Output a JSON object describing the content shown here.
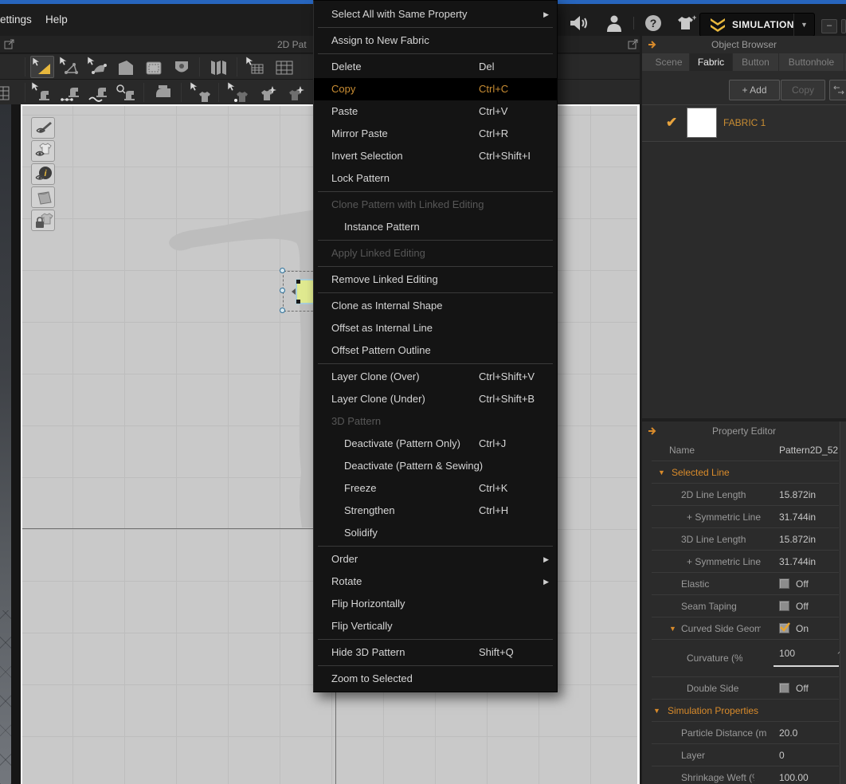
{
  "menubar": {
    "items": [
      "ettings",
      "Help"
    ]
  },
  "topright": {
    "icons": [
      "speaker-icon",
      "user-icon",
      "help-icon",
      "add-garment-icon"
    ],
    "simulation_label": "SIMULATION",
    "minimize_label": "–"
  },
  "pattern_window": {
    "title": "2D Pat",
    "toolbar_row1": [
      "transform-pattern-tool",
      "edit-pattern-tool",
      "edit-curvature-tool",
      "polygon-tool",
      "rectangle-tool",
      "dart-tool",
      "sep",
      "pleats-tool",
      "sep",
      "trace-tool",
      "grid-tool"
    ],
    "toolbar_row2": [
      "edit-sewing-tool",
      "free-sewing-tool",
      "curved-sewing-tool",
      "detail-sewing-tool",
      "sep",
      "iron-tool",
      "sep",
      "select-garment-tool",
      "sep",
      "pin-garment-tool",
      "sparkle-garment-tool",
      "star-garment-tool"
    ],
    "canvas_buttons": [
      "show-needle-toggle",
      "show-garment-toggle",
      "show-info-toggle",
      "show-fabric-toggle",
      "lock-garment-toggle"
    ]
  },
  "object_browser": {
    "title": "Object Browser",
    "tabs": [
      "Scene",
      "Fabric",
      "Button",
      "Buttonhole"
    ],
    "active_tab": "Fabric",
    "add_label": "+  Add",
    "copy_label": "Copy",
    "fabric_item": {
      "name": "FABRIC 1",
      "checked": true
    }
  },
  "property_editor": {
    "title": "Property Editor",
    "rows": [
      {
        "type": "text",
        "label": "Name",
        "value": "Pattern2D_52",
        "indent": 1
      },
      {
        "type": "section",
        "label": "Selected Line",
        "level": 1
      },
      {
        "type": "text",
        "label": "2D Line Length",
        "value": "15.872in",
        "indent": 2,
        "clip": 83
      },
      {
        "type": "text",
        "label": "+ Symmetric Line",
        "value": "31.744in",
        "indent": 3
      },
      {
        "type": "text",
        "label": "3D Line Length",
        "value": "15.872in",
        "indent": 2,
        "clip": 83
      },
      {
        "type": "text",
        "label": "+ Symmetric Line",
        "value": "31.744in",
        "indent": 3
      },
      {
        "type": "checkbox",
        "label": "Elastic",
        "value": "Off",
        "checked": false,
        "indent": 2
      },
      {
        "type": "checkbox",
        "label": "Seam Taping",
        "value": "Off",
        "checked": false,
        "indent": 2
      },
      {
        "type": "checkbox",
        "label": "Curved Side Geometry",
        "value": "On",
        "checked": true,
        "indent": 2,
        "arrow": true,
        "clip": 100
      },
      {
        "type": "slider",
        "label": "Curvature (%)",
        "value": "100",
        "indent": 3,
        "clip": 70
      },
      {
        "type": "checkbox",
        "label": "Double Side",
        "value": "Off",
        "checked": false,
        "indent": 3,
        "clip": 66
      },
      {
        "type": "section",
        "label": "Simulation Properties",
        "level": 0
      },
      {
        "type": "text",
        "label": "Particle Distance (mm)",
        "value": "20.0",
        "indent": 2,
        "clip": 108
      },
      {
        "type": "text",
        "label": "Layer",
        "value": "0",
        "indent": 2
      },
      {
        "type": "text",
        "label": "Shrinkage Weft (%)",
        "value": "100.00",
        "indent": 2,
        "clip": 92
      }
    ]
  },
  "context_menu": {
    "items": [
      {
        "label": "Select All with Same Property",
        "submenu": true,
        "sep": true
      },
      {
        "label": "Assign to New Fabric",
        "sep": true
      },
      {
        "label": "Delete",
        "shortcut": "Del"
      },
      {
        "label": "Copy",
        "shortcut": "Ctrl+C",
        "highlighted": true
      },
      {
        "label": "Paste",
        "shortcut": "Ctrl+V"
      },
      {
        "label": "Mirror Paste",
        "shortcut": "Ctrl+R"
      },
      {
        "label": "Invert Selection",
        "shortcut": "Ctrl+Shift+I"
      },
      {
        "label": "Lock Pattern",
        "sep": true
      },
      {
        "label": "Clone Pattern with Linked Editing",
        "disabled": true
      },
      {
        "label": "Instance Pattern",
        "indent": 1,
        "sep": true
      },
      {
        "label": "Apply Linked Editing",
        "disabled": true,
        "sep": true
      },
      {
        "label": "Remove Linked Editing",
        "sep": true
      },
      {
        "label": "Clone as Internal Shape"
      },
      {
        "label": "Offset as Internal Line"
      },
      {
        "label": "Offset Pattern Outline",
        "sep": true
      },
      {
        "label": "Layer Clone (Over)",
        "shortcut": "Ctrl+Shift+V"
      },
      {
        "label": "Layer Clone (Under)",
        "shortcut": "Ctrl+Shift+B"
      },
      {
        "label": "3D Pattern",
        "disabled": true
      },
      {
        "label": "Deactivate (Pattern Only)",
        "shortcut": "Ctrl+J",
        "indent": 1
      },
      {
        "label": "Deactivate (Pattern & Sewing)",
        "indent": 1
      },
      {
        "label": "Freeze",
        "shortcut": "Ctrl+K",
        "indent": 1
      },
      {
        "label": "Strengthen",
        "shortcut": "Ctrl+H",
        "indent": 1
      },
      {
        "label": "Solidify",
        "indent": 1,
        "sep": true
      },
      {
        "label": "Order",
        "submenu": true
      },
      {
        "label": "Rotate",
        "submenu": true
      },
      {
        "label": "Flip Horizontally"
      },
      {
        "label": "Flip Vertically",
        "sep": true
      },
      {
        "label": "Hide 3D Pattern",
        "shortcut": "Shift+Q",
        "sep": true
      },
      {
        "label": "Zoom to Selected"
      }
    ]
  },
  "colors": {
    "accent_orange": "#d98b2b",
    "highlight_text": "#c98d33",
    "selection_blue": "#2f7099",
    "canvas": "#c9c9c9"
  }
}
